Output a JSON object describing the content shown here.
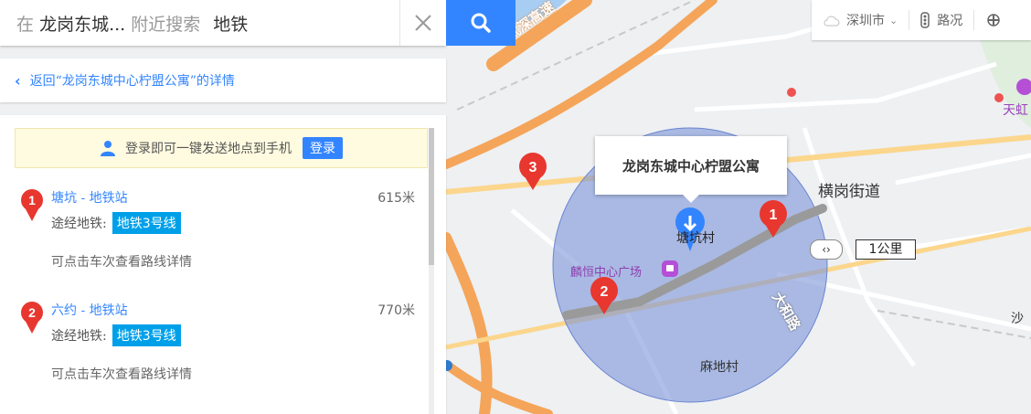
{
  "search": {
    "prefix": "在",
    "location": "龙岗东城...",
    "mode": "附近搜索",
    "keyword": "地铁",
    "clear_icon": "close-icon",
    "search_icon": "search-icon"
  },
  "back_link": {
    "label": "返回“龙岗东城中心柠盟公寓”的详情"
  },
  "login_tip": {
    "text": "登录即可一键发送地点到手机",
    "button": "登录"
  },
  "results": [
    {
      "index": "1",
      "name": "塘坑 - 地铁站",
      "distance": "615米",
      "via_label": "途经地铁:",
      "line": "地铁3号线",
      "hint": "可点击车次查看路线详情"
    },
    {
      "index": "2",
      "name": "六约 - 地铁站",
      "distance": "770米",
      "via_label": "途经地铁:",
      "line": "地铁3号线",
      "hint": "可点击车次查看路线详情"
    }
  ],
  "tools": {
    "city": "深圳市",
    "traffic": "路况"
  },
  "map": {
    "callout": "龙岗东城中心柠盟公寓",
    "road_wushen": "武深高速",
    "street_henggang": "横岗街道",
    "poi_mall": "麟恒中心广场",
    "road_dahe": "大和路",
    "village_madi": "麻地村",
    "village_partial": "塘坑村",
    "poi_tianhong": "天虹",
    "road_sha": "沙",
    "scale": "1公里",
    "pin3": "3",
    "pin1": "1",
    "pin2": "2"
  },
  "colors": {
    "accent": "#3385ff",
    "line_tag": "#00a0e9",
    "pin": "#e8372f",
    "radius_fill": "#7c94d9",
    "highway": "#f4a55a"
  }
}
